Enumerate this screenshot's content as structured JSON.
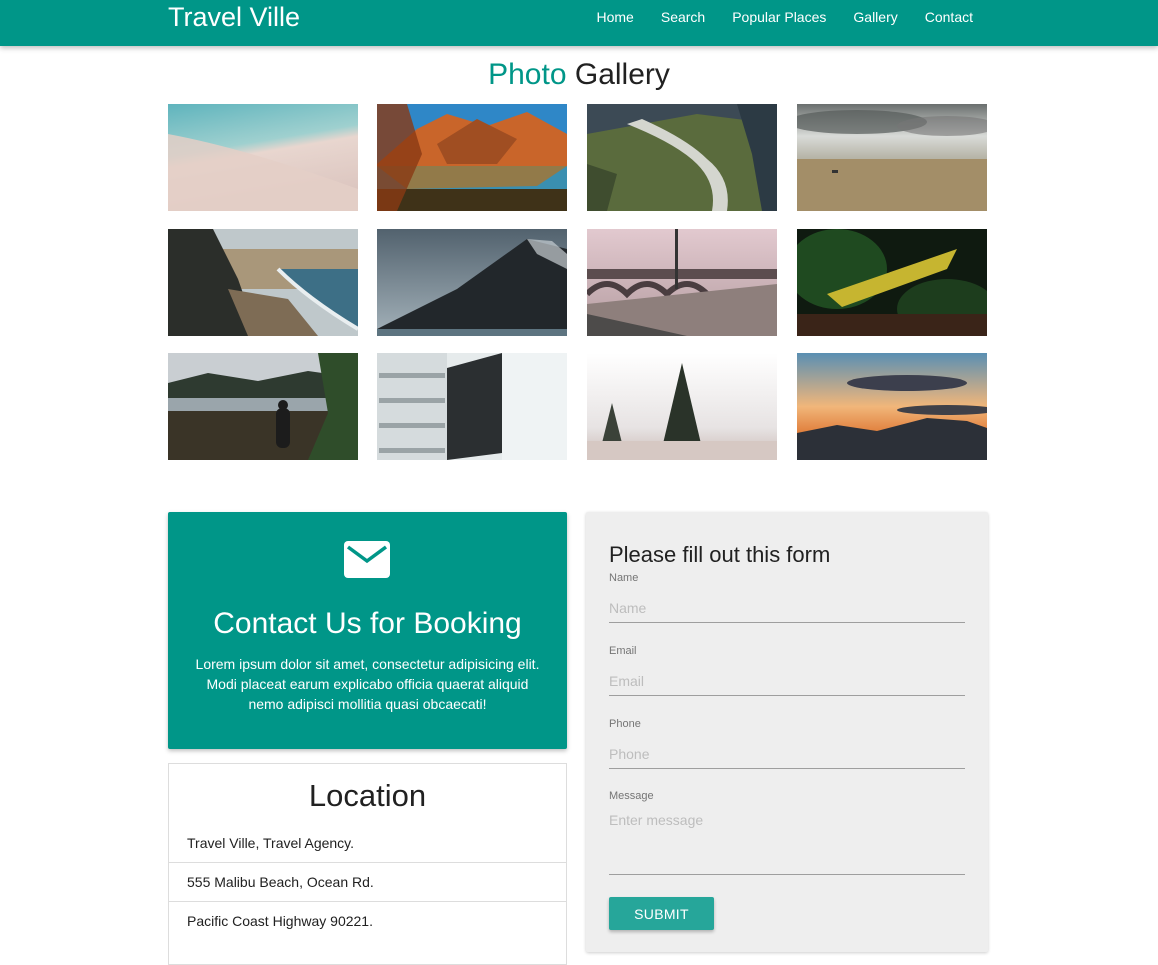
{
  "nav": {
    "brand": "Travel Ville",
    "links": [
      "Home",
      "Search",
      "Popular Places",
      "Gallery",
      "Contact"
    ],
    "color": "#009688"
  },
  "gallery": {
    "title_accent": "Photo",
    "title_rest": "Gallery",
    "photos": [
      "beach-shore",
      "autumn-mountain-lake",
      "river-valley-aerial",
      "cloudy-plains",
      "coastal-cliff-beach",
      "dark-mountain-slope",
      "bridge-power-lines",
      "yellow-boat-forest",
      "forest-shore-hiker",
      "building-facade",
      "snowy-pine-trees",
      "sunset-mountains"
    ]
  },
  "contact": {
    "icon": "mail-icon",
    "heading": "Contact Us for Booking",
    "text": "Lorem ipsum dolor sit amet, consectetur adipisicing elit. Modi placeat earum explicabo officia quaerat aliquid nemo adipisci mollitia quasi obcaecati!"
  },
  "location": {
    "title": "Location",
    "items": [
      "Travel Ville, Travel Agency.",
      "555 Malibu Beach, Ocean Rd.",
      "Pacific Coast Highway 90221."
    ]
  },
  "form": {
    "title": "Please fill out this form",
    "name_label": "Name",
    "name_placeholder": "Name",
    "email_label": "Email",
    "email_placeholder": "Email",
    "phone_label": "Phone",
    "phone_placeholder": "Phone",
    "message_label": "Message",
    "message_placeholder": "Enter message",
    "submit": "SUBMIT"
  }
}
